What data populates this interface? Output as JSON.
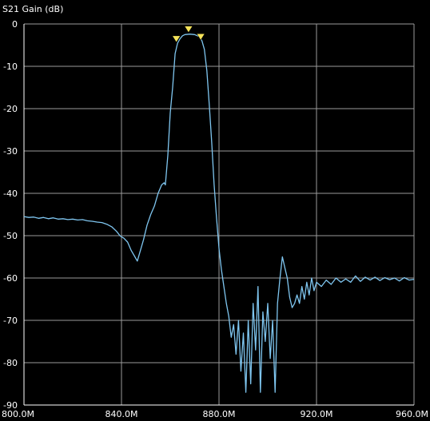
{
  "chart_data": {
    "type": "line",
    "ylabel": "S21 Gain (dB)",
    "x_unit": "Hz",
    "xlim": [
      800000000,
      960000000
    ],
    "ylim": [
      -90,
      0
    ],
    "grid": true,
    "x_ticks": [
      {
        "value": 800000000,
        "label": "800.0M"
      },
      {
        "value": 840000000,
        "label": "840.0M"
      },
      {
        "value": 880000000,
        "label": "880.0M"
      },
      {
        "value": 920000000,
        "label": "920.0M"
      },
      {
        "value": 960000000,
        "label": "960.0M"
      }
    ],
    "y_ticks": [
      {
        "value": 0,
        "label": "0"
      },
      {
        "value": -10,
        "label": "-10"
      },
      {
        "value": -20,
        "label": "-20"
      },
      {
        "value": -30,
        "label": "-30"
      },
      {
        "value": -40,
        "label": "-40"
      },
      {
        "value": -50,
        "label": "-50"
      },
      {
        "value": -60,
        "label": "-60"
      },
      {
        "value": -70,
        "label": "-70"
      },
      {
        "value": -80,
        "label": "-80"
      },
      {
        "value": -90,
        "label": "-90"
      }
    ],
    "series": [
      {
        "color": "#7fc6f0",
        "points": [
          [
            800000000,
            -45.5
          ],
          [
            802000000,
            -45.7
          ],
          [
            804000000,
            -45.6
          ],
          [
            806000000,
            -45.9
          ],
          [
            808000000,
            -45.7
          ],
          [
            810000000,
            -46.0
          ],
          [
            812000000,
            -45.8
          ],
          [
            814000000,
            -46.1
          ],
          [
            816000000,
            -46.0
          ],
          [
            818000000,
            -46.2
          ],
          [
            820000000,
            -46.1
          ],
          [
            822000000,
            -46.3
          ],
          [
            824000000,
            -46.2
          ],
          [
            826000000,
            -46.5
          ],
          [
            828000000,
            -46.6
          ],
          [
            830000000,
            -46.8
          ],
          [
            832000000,
            -46.9
          ],
          [
            834000000,
            -47.3
          ],
          [
            836000000,
            -47.9
          ],
          [
            838000000,
            -49.0
          ],
          [
            839500000,
            -50.1
          ],
          [
            841000000,
            -50.6
          ],
          [
            842500000,
            -51.5
          ],
          [
            844000000,
            -53.5
          ],
          [
            845500000,
            -55.0
          ],
          [
            846500000,
            -56.0
          ],
          [
            847500000,
            -54.0
          ],
          [
            849000000,
            -51.0
          ],
          [
            850500000,
            -47.5
          ],
          [
            852000000,
            -45.0
          ],
          [
            853500000,
            -43.0
          ],
          [
            855000000,
            -40.0
          ],
          [
            856500000,
            -38.0
          ],
          [
            857500000,
            -37.5
          ],
          [
            858000000,
            -38.0
          ],
          [
            859000000,
            -31.0
          ],
          [
            860000000,
            -21.0
          ],
          [
            861000000,
            -15.0
          ],
          [
            862000000,
            -7.0
          ],
          [
            863000000,
            -4.5
          ],
          [
            864000000,
            -3.5
          ],
          [
            865000000,
            -2.8
          ],
          [
            866000000,
            -2.5
          ],
          [
            868000000,
            -2.4
          ],
          [
            870000000,
            -2.5
          ],
          [
            872000000,
            -3.0
          ],
          [
            873000000,
            -4.0
          ],
          [
            874000000,
            -6.0
          ],
          [
            875000000,
            -11.0
          ],
          [
            876000000,
            -19.0
          ],
          [
            877000000,
            -28.0
          ],
          [
            878000000,
            -38.0
          ],
          [
            879000000,
            -46.0
          ],
          [
            880000000,
            -53.0
          ],
          [
            881000000,
            -58.0
          ],
          [
            882000000,
            -62.0
          ],
          [
            883000000,
            -66.0
          ],
          [
            884000000,
            -69.0
          ],
          [
            885000000,
            -74.0
          ],
          [
            886000000,
            -71.0
          ],
          [
            887000000,
            -78.0
          ],
          [
            888000000,
            -70.0
          ],
          [
            889000000,
            -82.0
          ],
          [
            890000000,
            -73.0
          ],
          [
            891000000,
            -87.0
          ],
          [
            892000000,
            -70.0
          ],
          [
            893000000,
            -85.0
          ],
          [
            894000000,
            -66.0
          ],
          [
            895000000,
            -77.0
          ],
          [
            896000000,
            -62.0
          ],
          [
            897000000,
            -87.0
          ],
          [
            898000000,
            -68.0
          ],
          [
            899000000,
            -75.0
          ],
          [
            900000000,
            -66.0
          ],
          [
            901000000,
            -79.0
          ],
          [
            902000000,
            -70.0
          ],
          [
            903000000,
            -87.0
          ],
          [
            904000000,
            -66.0
          ],
          [
            905000000,
            -60.0
          ],
          [
            906000000,
            -55.0
          ],
          [
            907000000,
            -57.5
          ],
          [
            908000000,
            -60.0
          ],
          [
            909000000,
            -64.5
          ],
          [
            910000000,
            -67.0
          ],
          [
            911000000,
            -66.0
          ],
          [
            912000000,
            -64.0
          ],
          [
            913000000,
            -66.0
          ],
          [
            914000000,
            -62.0
          ],
          [
            915000000,
            -65.0
          ],
          [
            916000000,
            -61.0
          ],
          [
            917000000,
            -64.0
          ],
          [
            918000000,
            -60.0
          ],
          [
            919000000,
            -63.0
          ],
          [
            920000000,
            -61.0
          ],
          [
            922000000,
            -62.0
          ],
          [
            924000000,
            -60.5
          ],
          [
            926000000,
            -61.5
          ],
          [
            928000000,
            -60.0
          ],
          [
            930000000,
            -61.0
          ],
          [
            932000000,
            -60.2
          ],
          [
            934000000,
            -61.0
          ],
          [
            936000000,
            -59.5
          ],
          [
            938000000,
            -60.8
          ],
          [
            940000000,
            -59.8
          ],
          [
            942000000,
            -60.5
          ],
          [
            944000000,
            -59.8
          ],
          [
            946000000,
            -60.6
          ],
          [
            948000000,
            -59.9
          ],
          [
            950000000,
            -60.4
          ],
          [
            952000000,
            -60.0
          ],
          [
            954000000,
            -60.7
          ],
          [
            956000000,
            -59.9
          ],
          [
            958000000,
            -60.5
          ],
          [
            960000000,
            -60.3
          ]
        ]
      }
    ],
    "markers": [
      {
        "x": 862500000,
        "y": -4.5,
        "color": "#f5e35a"
      },
      {
        "x": 867500000,
        "y": -2.2,
        "color": "#f5e35a"
      },
      {
        "x": 872500000,
        "y": -4.0,
        "color": "#f5e35a"
      }
    ]
  }
}
